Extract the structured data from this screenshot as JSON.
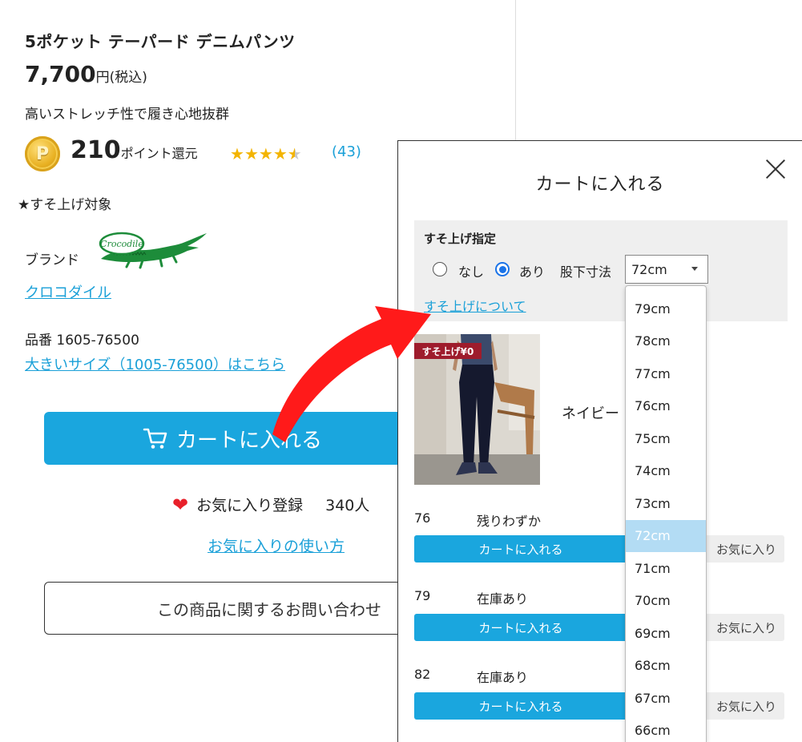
{
  "product": {
    "title": "5ポケット テーパード デニムパンツ",
    "price_value": "7,700",
    "price_unit": "円(税込)",
    "catch_copy": "高いストレッチ性で履き心地抜群",
    "point_icon_letter": "P",
    "points_value": "210",
    "points_text": "ポイント還元",
    "rating_stars": 4.5,
    "review_count": "(43)",
    "hem_target": "★すそ上げ対象",
    "brand_label": "ブランド",
    "brand_logo_text": "Crocodile",
    "brand_link": "クロコダイル",
    "item_number": "品番  1605-76500",
    "big_size_link": "大きいサイズ（1005-76500）はこちら",
    "cart_button": "カートに入れる",
    "favorite_label": "お気に入り登録",
    "favorite_count": "340人",
    "favorite_howto": "お気に入りの使い方",
    "inquiry_button": "この商品に関するお問い合わせ"
  },
  "modal": {
    "title": "カートに入れる",
    "hem": {
      "title": "すそ上げ指定",
      "option_none": "なし",
      "option_yes": "あり",
      "selected_option": "あり",
      "inseam_label": "股下寸法",
      "inseam_value": "72cm",
      "about_link": "すそ上げについて"
    },
    "photo_badge": "すそ上げ¥0",
    "color_name": "ネイビー",
    "sizes": [
      {
        "size": "76",
        "stock": "残りわずか",
        "cart": "カートに入れる",
        "fav": "お気に入り"
      },
      {
        "size": "79",
        "stock": "在庫あり",
        "cart": "カートに入れる",
        "fav": "お気に入り"
      },
      {
        "size": "82",
        "stock": "在庫あり",
        "cart": "カートに入れる",
        "fav": "お気に入り"
      }
    ]
  },
  "dropdown": {
    "options": [
      "79cm",
      "78cm",
      "77cm",
      "76cm",
      "75cm",
      "74cm",
      "73cm",
      "72cm",
      "71cm",
      "70cm",
      "69cm",
      "68cm",
      "67cm",
      "66cm"
    ],
    "selected": "72cm"
  },
  "colors": {
    "accent_blue": "#1aa6de",
    "link_blue": "#1aa0d8",
    "arrow_red": "#ff1a1a",
    "heart_red": "#e8202a",
    "star_gold": "#f3b400",
    "badge_red": "#9e1c2c",
    "selected_option_bg": "#b3dcf4"
  }
}
